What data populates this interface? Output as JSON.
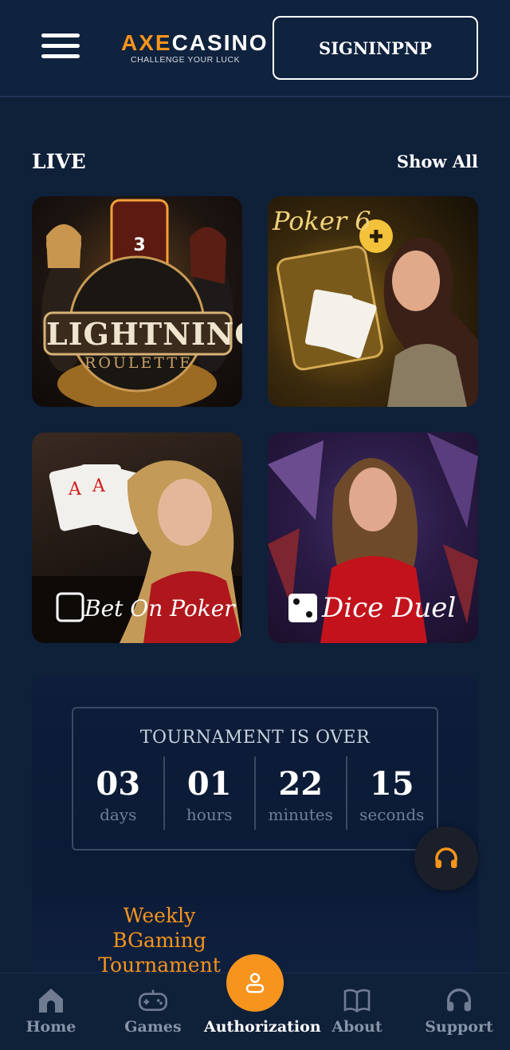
{
  "header": {
    "logo_axe": "AXE",
    "logo_casino": "CASINO",
    "logo_tagline": "CHALLENGE YOUR LUCK",
    "signin_label": "SIGNINPNP"
  },
  "live_section": {
    "title": "LIVE",
    "show_all_label": "Show All",
    "games": [
      {
        "title": "LIGHTNING",
        "subtitle": "ROULETTE",
        "icon": "roulette-icon"
      },
      {
        "title": "Poker 6",
        "icon": "poker-icon"
      },
      {
        "title": "Bet On Poker",
        "icon": "cards-icon"
      },
      {
        "title": "Dice Duel",
        "icon": "dice-icon"
      }
    ]
  },
  "tournament": {
    "status": "TOURNAMENT IS OVER",
    "timer": [
      {
        "value": "03",
        "unit": "days"
      },
      {
        "value": "01",
        "unit": "hours"
      },
      {
        "value": "22",
        "unit": "minutes"
      },
      {
        "value": "15",
        "unit": "seconds"
      }
    ],
    "name_line1": "Weekly BGaming",
    "name_line2": "Tournament"
  },
  "support_fab": {
    "icon": "headphones-icon"
  },
  "colors": {
    "accent": "#f7941d",
    "background": "#0f2039"
  },
  "bottom_nav": {
    "items": [
      {
        "label": "Home",
        "icon": "home-icon",
        "active": false
      },
      {
        "label": "Games",
        "icon": "gamepad-icon",
        "active": false
      },
      {
        "label": "Authorization",
        "icon": "user-icon",
        "active": true
      },
      {
        "label": "About",
        "icon": "book-icon",
        "active": false
      },
      {
        "label": "Support",
        "icon": "headphones-icon",
        "active": false
      }
    ]
  }
}
